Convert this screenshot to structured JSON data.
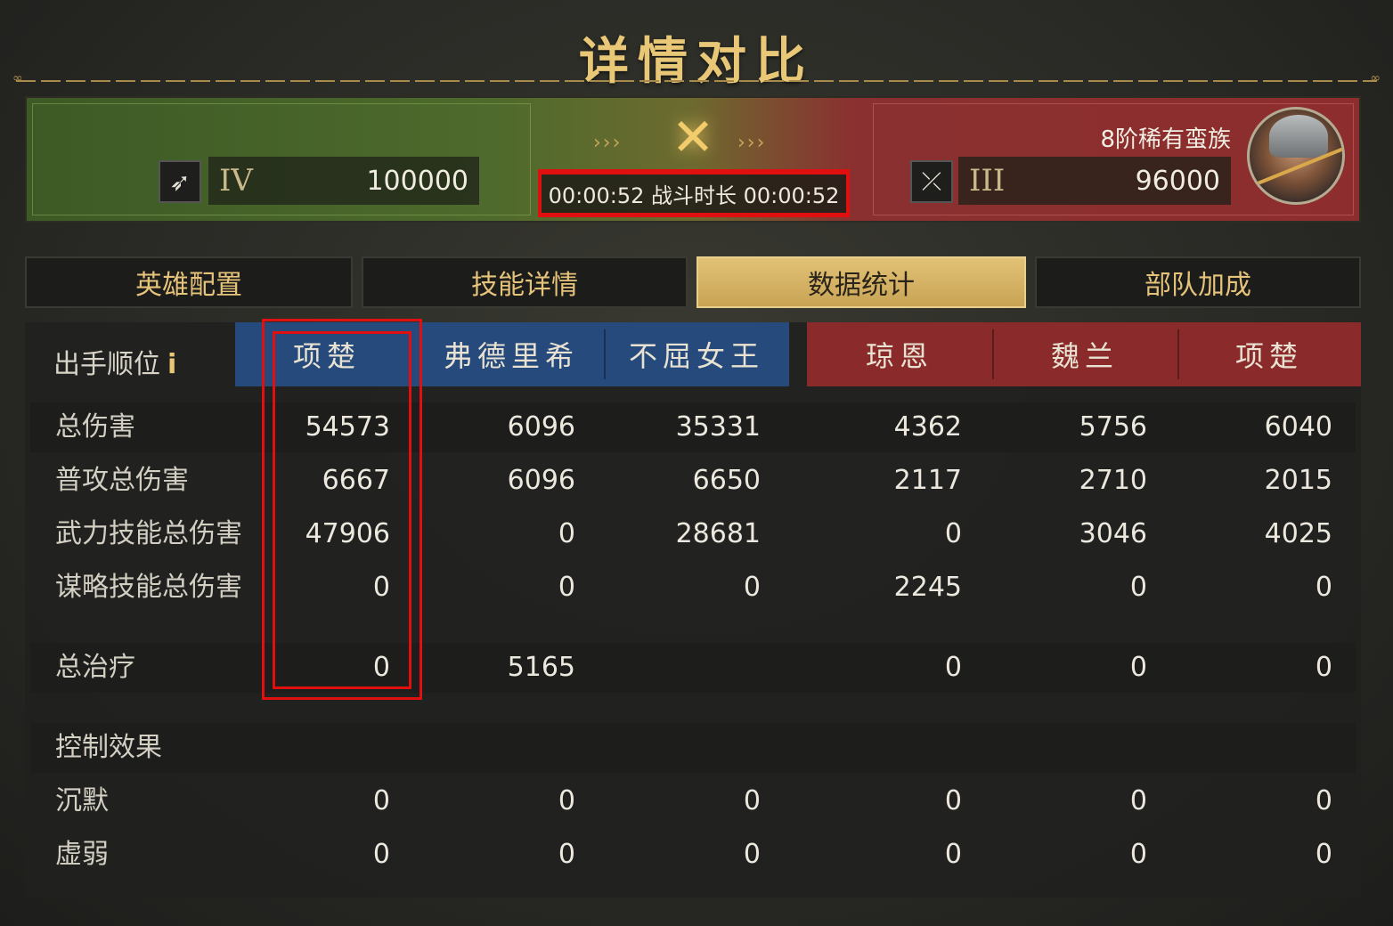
{
  "title": "详情对比",
  "battle": {
    "left": {
      "rank": "IV",
      "troops": "100000",
      "unit_icon": "spear-icon"
    },
    "right": {
      "rank": "III",
      "troops": "96000",
      "unit_icon": "bow-icon",
      "title": "8阶稀有蛮族"
    },
    "duration_text": "00:00:52 战斗时长 00:00:52",
    "arrows": "›››"
  },
  "tabs": [
    {
      "label": "英雄配置",
      "active": false
    },
    {
      "label": "技能详情",
      "active": false
    },
    {
      "label": "数据统计",
      "active": true
    },
    {
      "label": "部队加成",
      "active": false
    }
  ],
  "table": {
    "order_label": "出手顺位",
    "info_glyph": "i",
    "heroes": [
      "项楚",
      "弗德里希",
      "不屈女王",
      "琼恩",
      "魏兰",
      "项楚"
    ],
    "rows": [
      {
        "label": "总伤害",
        "values": [
          "54573",
          "6096",
          "35331",
          "4362",
          "5756",
          "6040"
        ]
      },
      {
        "label": "普攻总伤害",
        "values": [
          "6667",
          "6096",
          "6650",
          "2117",
          "2710",
          "2015"
        ]
      },
      {
        "label": "武力技能总伤害",
        "values": [
          "47906",
          "0",
          "28681",
          "0",
          "3046",
          "4025"
        ]
      },
      {
        "label": "谋略技能总伤害",
        "values": [
          "0",
          "0",
          "0",
          "2245",
          "0",
          "0"
        ]
      },
      {
        "label": "总治疗",
        "values": [
          "0",
          "5165",
          "",
          "0",
          "0",
          "0"
        ]
      },
      {
        "label": "控制效果",
        "values": [
          "",
          "",
          "",
          "",
          "",
          ""
        ]
      },
      {
        "label": "沉默",
        "values": [
          "0",
          "0",
          "0",
          "0",
          "0",
          "0"
        ]
      },
      {
        "label": "虚弱",
        "values": [
          "0",
          "0",
          "0",
          "0",
          "0",
          "0"
        ]
      }
    ]
  },
  "colors": {
    "accent": "#e8c777",
    "ally": "#274a7c",
    "enemy": "#8a2a2a",
    "highlight": "#e01010"
  }
}
